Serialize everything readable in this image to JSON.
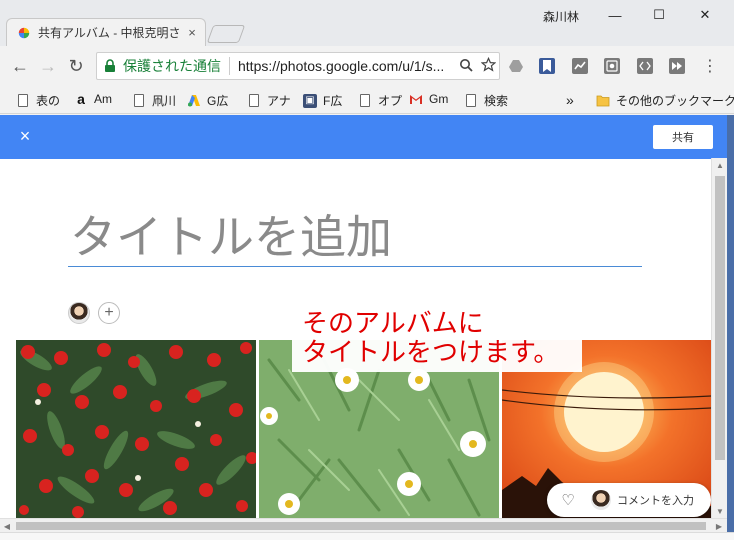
{
  "window": {
    "tab_title": "共有アルバム - 中根克明さ",
    "tab_close": "×",
    "user_name": "森川林",
    "minimize": "—",
    "maximize": "☐",
    "close": "✕"
  },
  "toolbar": {
    "back": "←",
    "forward": "→",
    "reload": "↻",
    "secure_label": "保護された通信",
    "url": "https://photos.google.com/u/1/s...",
    "menu": "⋮"
  },
  "bookmarks": {
    "items": [
      {
        "label": "表の",
        "icon": "page-icon"
      },
      {
        "label": "Am",
        "icon": "amazon-icon"
      },
      {
        "label": "凧川",
        "icon": "page-icon"
      },
      {
        "label": "G広",
        "icon": "google-ads-icon"
      },
      {
        "label": "アナ",
        "icon": "page-icon"
      },
      {
        "label": "F広",
        "icon": "facebook-ads-icon"
      },
      {
        "label": "オプ",
        "icon": "page-icon"
      },
      {
        "label": "Gm",
        "icon": "gmail-icon"
      },
      {
        "label": "検索",
        "icon": "page-icon"
      }
    ],
    "overflow": "»",
    "other_bookmarks": "その他のブックマーク"
  },
  "appbar": {
    "close": "×",
    "share_label": "共有",
    "color": "#4285f4"
  },
  "album": {
    "title_placeholder": "タイトルを追加",
    "add_person": "+"
  },
  "annotation": {
    "line1": "そのアルバムに",
    "line2": "タイトルをつけます。",
    "color": "#e00000"
  },
  "photos": [
    {
      "subject": "red berries with green leaves"
    },
    {
      "subject": "white daisy flowers in grass"
    },
    {
      "subject": "orange sunset sky with power lines"
    }
  ],
  "comment": {
    "heart": "♡",
    "label": "コメントを入力"
  }
}
